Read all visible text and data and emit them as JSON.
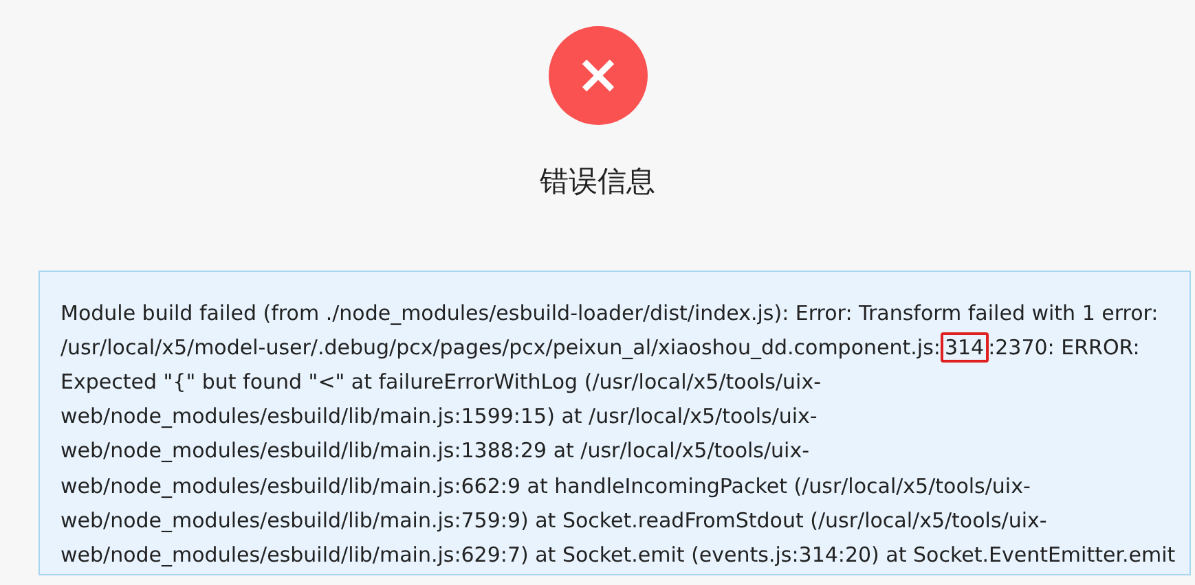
{
  "status": {
    "kind": "error"
  },
  "title": "错误信息",
  "message": {
    "before": "Module build failed (from ./node_modules/esbuild-loader/dist/index.js): Error: Transform failed with 1 error: /usr/local/x5/model-user/.debug/pcx/pages/pcx/peixun_al/xiaoshou_dd.component.js:",
    "highlight": "314",
    "after": ":2370: ERROR: Expected \"{\" but found \"<\" at failureErrorWithLog (/usr/local/x5/tools/uix-web/node_modules/esbuild/lib/main.js:1599:15) at /usr/local/x5/tools/uix-web/node_modules/esbuild/lib/main.js:1388:29 at /usr/local/x5/tools/uix-web/node_modules/esbuild/lib/main.js:662:9 at handleIncomingPacket (/usr/local/x5/tools/uix-web/node_modules/esbuild/lib/main.js:759:9) at Socket.readFromStdout (/usr/local/x5/tools/uix-web/node_modules/esbuild/lib/main.js:629:7) at Socket.emit (events.js:314:20) at Socket.EventEmitter.emit"
  }
}
